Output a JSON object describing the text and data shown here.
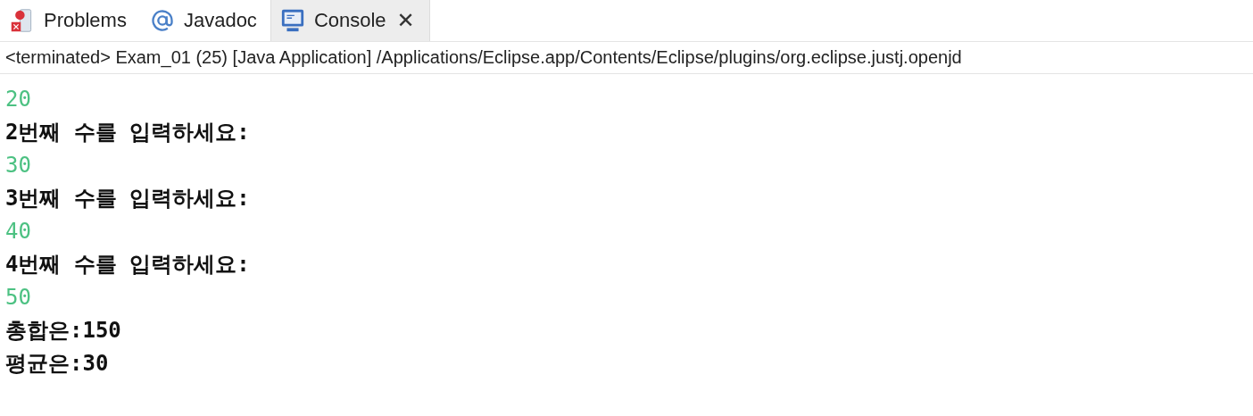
{
  "tabs": [
    {
      "label": "Problems",
      "selected": false,
      "closable": false
    },
    {
      "label": "Javadoc",
      "selected": false,
      "closable": false
    },
    {
      "label": "Console",
      "selected": true,
      "closable": true
    }
  ],
  "close_glyph": "✕",
  "status": "<terminated> Exam_01 (25) [Java Application] /Applications/Eclipse.app/Contents/Eclipse/plugins/org.eclipse.justj.openjd",
  "lines": [
    {
      "kind": "input",
      "text": "20"
    },
    {
      "kind": "output",
      "text": "2번째 수를 입력하세요:"
    },
    {
      "kind": "input",
      "text": "30"
    },
    {
      "kind": "output",
      "text": "3번째 수를 입력하세요:"
    },
    {
      "kind": "input",
      "text": "40"
    },
    {
      "kind": "output",
      "text": "4번째 수를 입력하세요:"
    },
    {
      "kind": "input",
      "text": "50"
    },
    {
      "kind": "output",
      "text": "총합은:150"
    },
    {
      "kind": "output",
      "text": "평균은:30"
    }
  ]
}
